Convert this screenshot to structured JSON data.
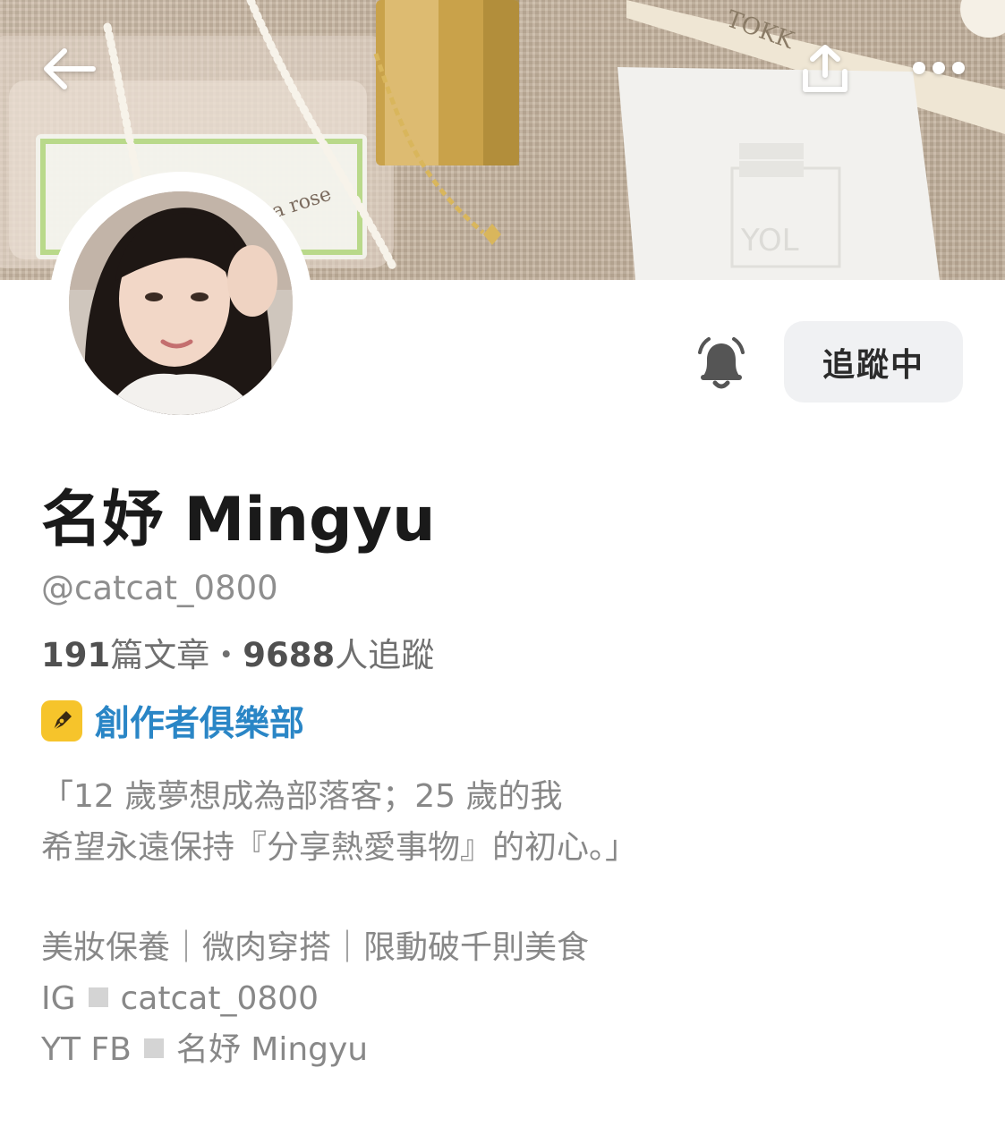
{
  "header": {
    "back_icon": "arrow-left-icon",
    "share_icon": "share-upload-icon",
    "more_icon": "more-dots-icon"
  },
  "cover": {
    "photo_text_card": "la rose",
    "photo_ribbon_text": "TOKK",
    "photo_card_logo": "YOL"
  },
  "profile": {
    "name": "名妤 Mingyu",
    "handle": "@catcat_0800",
    "posts_count": "191",
    "posts_label": " 篇文章",
    "separator": "・",
    "followers_count": "9688",
    "followers_label": " 人追蹤",
    "club_icon": "pen-icon",
    "club_label": "創作者俱樂部"
  },
  "actions": {
    "bell_icon": "bell-icon",
    "follow_label": "追蹤中"
  },
  "bio": {
    "line1": "「12 歲夢想成為部落客；25 歲的我",
    "line2": "希望永遠保持『分享熱愛事物』的初心。」",
    "line3": "美妝保養｜微肉穿搭｜限動破千則美食",
    "line4_prefix": "IG",
    "line4_value": "catcat_0800",
    "line5_prefix": "YT FB",
    "line5_value": "名妤 Mingyu"
  },
  "colors": {
    "accent_blue": "#2a86c6",
    "club_yellow": "#f6c42b",
    "follow_bg": "#f0f1f3",
    "muted_text": "#888888"
  }
}
